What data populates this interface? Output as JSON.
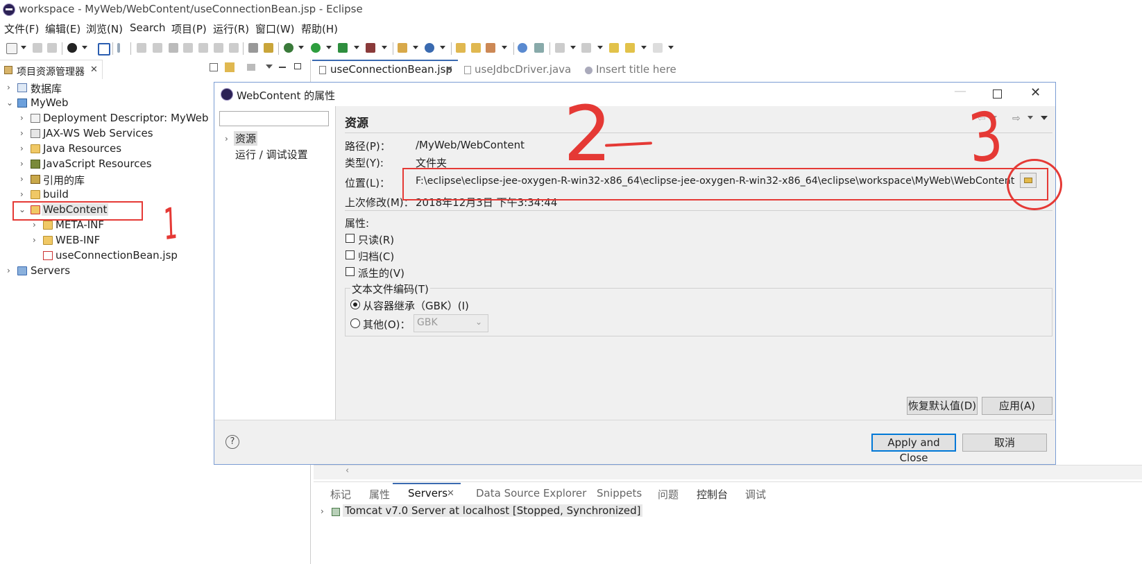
{
  "window": {
    "title": "workspace - MyWeb/WebContent/useConnectionBean.jsp - Eclipse"
  },
  "menu": [
    "文件(F)",
    "编辑(E)",
    "浏览(N)",
    "Search",
    "项目(P)",
    "运行(R)",
    "窗口(W)",
    "帮助(H)"
  ],
  "explorer": {
    "tab_label": "项目资源管理器",
    "tree": [
      {
        "label": "数据库"
      },
      {
        "label": "MyWeb"
      },
      {
        "label": "Deployment Descriptor: MyWeb"
      },
      {
        "label": "JAX-WS Web Services"
      },
      {
        "label": "Java Resources"
      },
      {
        "label": "JavaScript Resources"
      },
      {
        "label": "引用的库"
      },
      {
        "label": "build"
      },
      {
        "label": "WebContent"
      },
      {
        "label": "META-INF"
      },
      {
        "label": "WEB-INF"
      },
      {
        "label": "useConnectionBean.jsp"
      },
      {
        "label": "Servers"
      }
    ]
  },
  "editor_tabs": [
    "useConnectionBean.jsp",
    "useJdbcDriver.java",
    "Insert title here"
  ],
  "bottom_panel": {
    "tabs": [
      "标记",
      "属性",
      "Servers",
      "Data Source Explorer",
      "Snippets",
      "问题",
      "控制台",
      "调试"
    ],
    "server_row": "Tomcat v7.0 Server at localhost  [Stopped, Synchronized]"
  },
  "dialog": {
    "title": "WebContent 的属性",
    "filter_placeholder": "",
    "nav": [
      "资源",
      "运行 / 调试设置"
    ],
    "section_title": "资源",
    "path_label": "路径(P)：",
    "path_value": "/MyWeb/WebContent",
    "type_label": "类型(Y):",
    "type_value": "文件夹",
    "location_label": "位置(L)：",
    "location_value": "F:\\eclipse\\eclipse-jee-oxygen-R-win32-x86_64\\eclipse-jee-oxygen-R-win32-x86_64\\eclipse\\workspace\\MyWeb\\WebContent",
    "modified_label": "上次修改(M)：",
    "modified_value": "2018年12月3日 下午3:34:44",
    "attributes_label": "属性:",
    "checkboxes": [
      "只读(R)",
      "归档(C)",
      "派生的(V)"
    ],
    "encoding_group": "文本文件编码(T)",
    "radio_inherit": "从容器继承（GBK）(I)",
    "radio_other": "其他(O)：",
    "other_encoding": "GBK",
    "restore_button": "恢复默认值(D)",
    "apply_button": "应用(A)",
    "apply_close_button": "Apply and Close",
    "cancel_button": "取消",
    "help_glyph": "?"
  },
  "annotations": {
    "mark1": "1",
    "mark2": "2",
    "mark3": "3"
  },
  "colors": {
    "annotation_red": "#e53935",
    "default_button_border": "#0078d7"
  }
}
